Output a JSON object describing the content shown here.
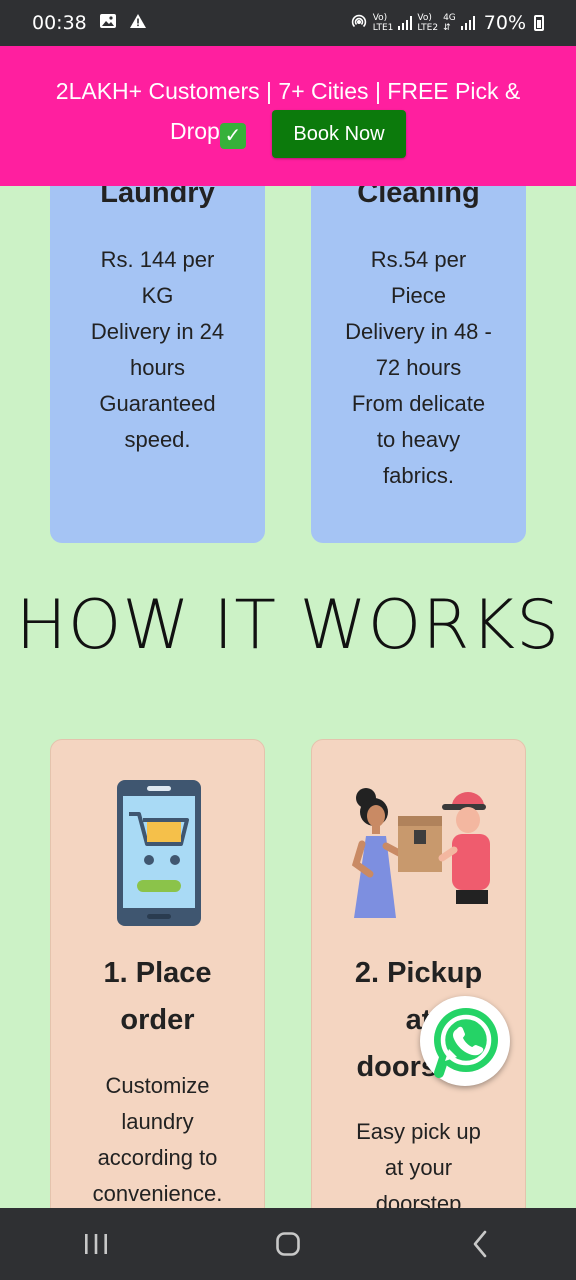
{
  "status_bar": {
    "time": "00:38",
    "net1_top": "Vo)",
    "net1_bottom": "LTE1",
    "net2_top": "Vo)",
    "net2_bottom": "LTE2",
    "net3_top": "4G",
    "battery": "70%"
  },
  "banner": {
    "text_line1": "2LAKH+ Customers | 7+ Cities | FREE Pick &",
    "text_line2": "Drop",
    "check_glyph": "✓",
    "book_label": "Book Now",
    "bg_color": "#ff1f9f",
    "button_color": "#0c7a0c"
  },
  "services": [
    {
      "title": "Laundry",
      "lines": [
        "Rs. 144 per",
        "KG",
        "Delivery in 24",
        "hours",
        "Guaranteed",
        "speed."
      ]
    },
    {
      "title": "Cleaning",
      "lines": [
        "Rs.54 per",
        "Piece",
        "Delivery in 48 -",
        "72 hours",
        "From delicate",
        "to heavy",
        "fabrics."
      ]
    }
  ],
  "how_it_works": {
    "title": "HOW IT WORKS",
    "steps": [
      {
        "title_lines": [
          "1. Place",
          "order"
        ],
        "body_lines": [
          "Customize",
          "laundry",
          "according to",
          "convenience."
        ],
        "icon": "phone-cart-icon"
      },
      {
        "title_lines": [
          "2. Pickup",
          "at",
          "doorstep"
        ],
        "body_lines": [
          "Easy pick up",
          "at your",
          "doorstep"
        ],
        "icon": "delivery-handover-icon"
      }
    ]
  },
  "floating": {
    "icon": "whatsapp-icon",
    "color": "#25d366"
  },
  "nav": {
    "recents_icon": "recents-icon",
    "home_icon": "home-icon",
    "back_icon": "back-icon"
  },
  "colors": {
    "page_bg": "#ccf2c6",
    "service_card": "#a5c4f4",
    "step_card": "#f4d5c1"
  }
}
